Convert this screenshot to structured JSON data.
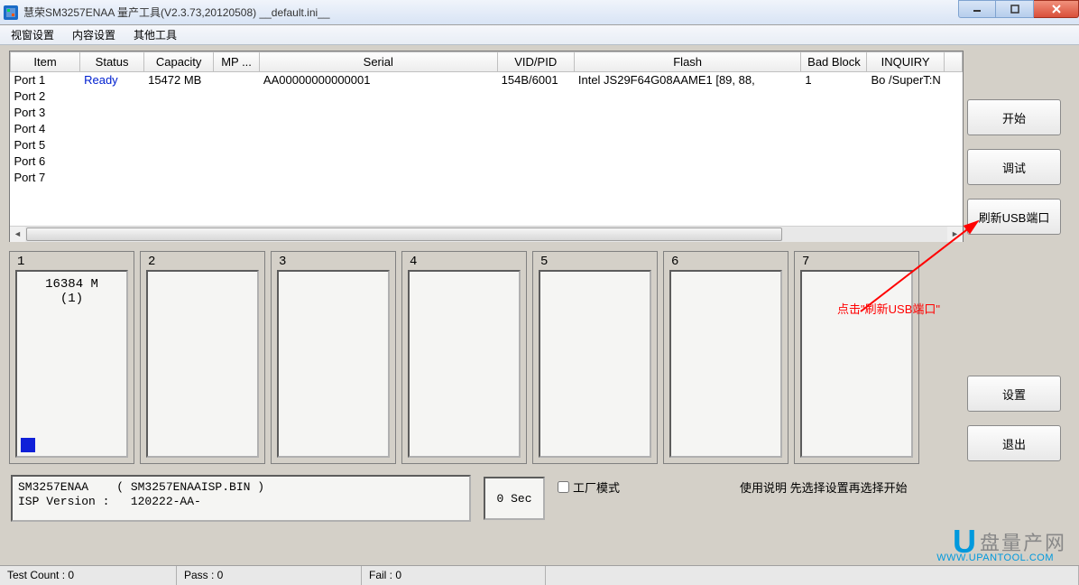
{
  "window": {
    "title": "慧荣SM3257ENAA 量产工具(V2.3.73,20120508)       __default.ini__"
  },
  "menu": {
    "viewport": "视窗设置",
    "content": "内容设置",
    "other": "其他工具"
  },
  "table": {
    "headers": {
      "item": "Item",
      "status": "Status",
      "capacity": "Capacity",
      "mp": "MP ...",
      "serial": "Serial",
      "vidpid": "VID/PID",
      "flash": "Flash",
      "badblock": "Bad Block",
      "inquiry": "INQUIRY"
    },
    "rows": [
      {
        "item": "Port 1",
        "status": "Ready",
        "capacity": "15472 MB",
        "mp": "",
        "serial": "AA00000000000001",
        "vidpid": "154B/6001",
        "flash": "Intel JS29F64G08AAME1 [89, 88,",
        "badblock": "1",
        "inquiry": "Bo  /SuperT:N"
      },
      {
        "item": "Port 2"
      },
      {
        "item": "Port 3"
      },
      {
        "item": "Port 4"
      },
      {
        "item": "Port 5"
      },
      {
        "item": "Port 6"
      },
      {
        "item": "Port 7"
      }
    ]
  },
  "buttons": {
    "start": "开始",
    "debug": "调试",
    "refresh_usb": "刷新USB端口",
    "settings": "设置",
    "exit": "退出"
  },
  "ports": [
    {
      "num": "1",
      "size": "16384 M",
      "idx": "(1)",
      "has_blue": true
    },
    {
      "num": "2"
    },
    {
      "num": "3"
    },
    {
      "num": "4"
    },
    {
      "num": "5"
    },
    {
      "num": "6"
    },
    {
      "num": "7"
    }
  ],
  "info": {
    "line1": "SM3257ENAA    ( SM3257ENAAISP.BIN )",
    "line2": "ISP Version :   120222-AA-"
  },
  "sec_box": "0 Sec",
  "factory_mode_label": "工厂模式",
  "usage_text": "使用说明  先选择设置再选择开始",
  "annotation": "点击\"刷新USB端口\"",
  "watermark": {
    "big": "U",
    "text": "盘量产网",
    "url": "WWW.UPANTOOL.COM"
  },
  "status": {
    "test_count": "Test Count : 0",
    "pass": "Pass : 0",
    "fail": "Fail : 0"
  }
}
